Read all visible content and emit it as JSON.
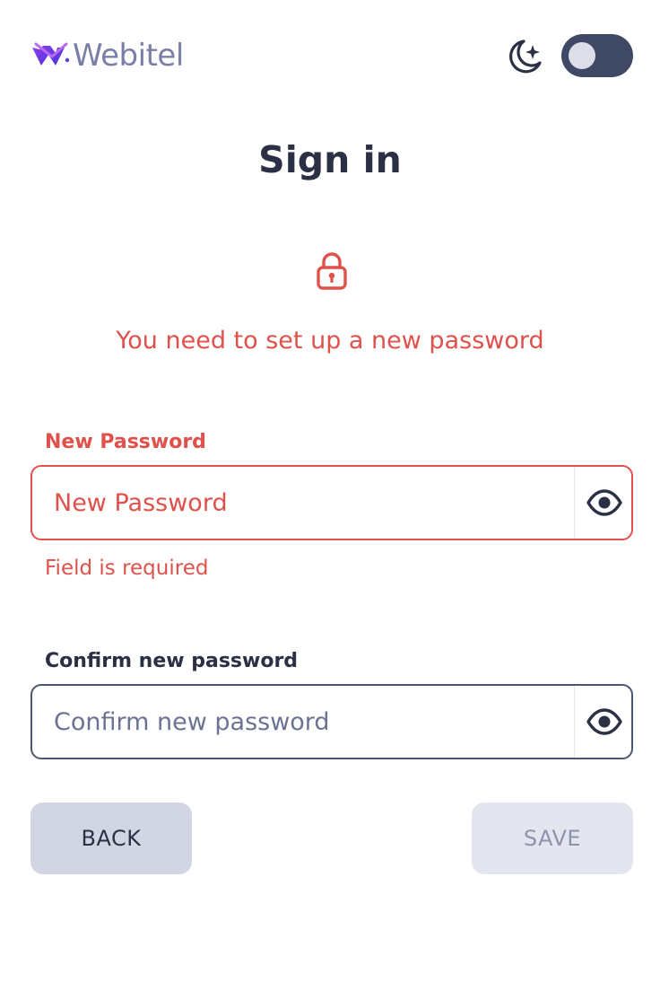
{
  "header": {
    "logo_text": "Webitel",
    "logo_icon": "webitel-logo-mark",
    "theme_icon": "moon-stars-icon",
    "dark_mode_enabled": false
  },
  "title": "Sign in",
  "lock_icon": "lock-icon",
  "alert_message": "You need to set up a new password",
  "new_password": {
    "label": "New Password",
    "placeholder": "New Password",
    "value": "",
    "error": "Field is required",
    "toggle_icon": "eye-icon"
  },
  "confirm_password": {
    "label": "Confirm new password",
    "placeholder": "Confirm new password",
    "value": "",
    "toggle_icon": "eye-icon"
  },
  "buttons": {
    "back": "BACK",
    "save": "SAVE"
  },
  "colors": {
    "error": "#e0514b",
    "text_primary": "#2b3044",
    "brand_purple": "#6b46e0",
    "toggle_track": "#3f4865",
    "button_back_bg": "#d2d6e4",
    "button_save_disabled_bg": "#e3e6ef"
  }
}
